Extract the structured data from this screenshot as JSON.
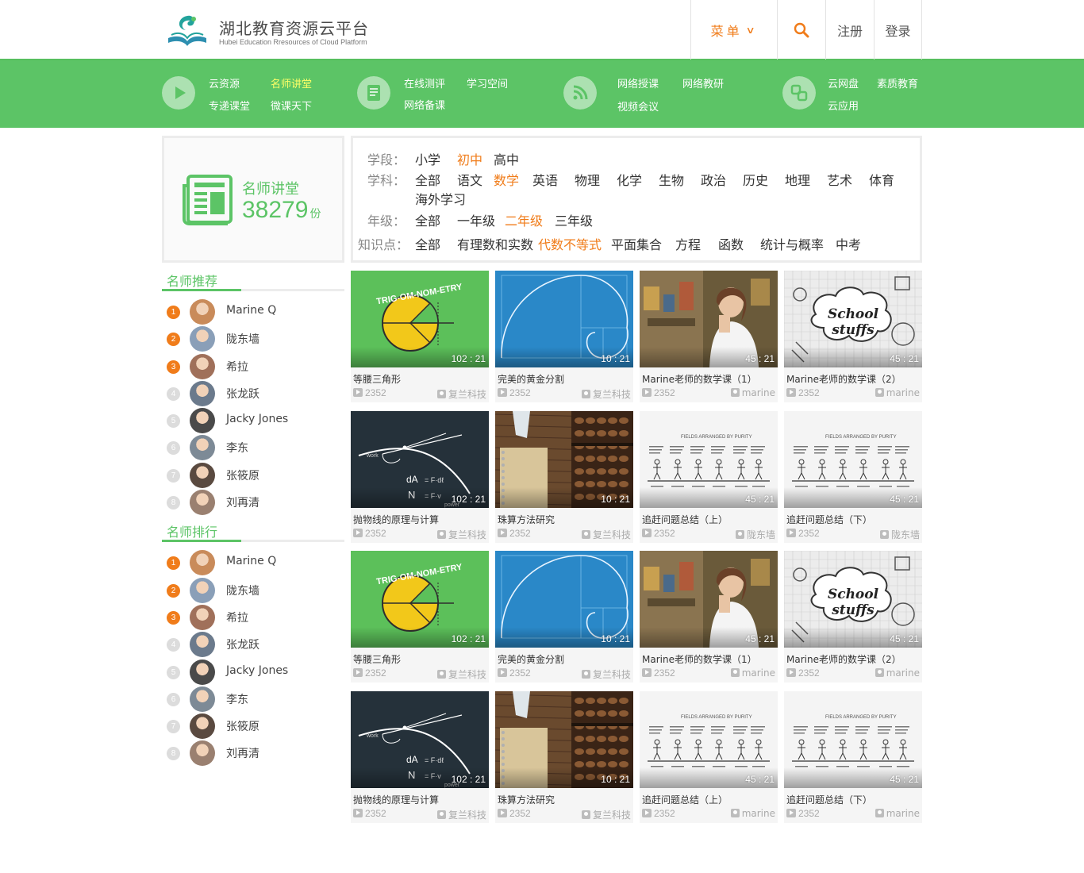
{
  "header": {
    "logo_title": "湖北教育资源云平台",
    "logo_subtitle": "Hubei Education Rresources of Cloud Platform",
    "menu_label": "菜单",
    "register_label": "注册",
    "login_label": "登录"
  },
  "green_nav": {
    "groups": [
      {
        "icon": "play-circle-icon",
        "links": [
          "云资源",
          "名师讲堂",
          "专递课堂",
          "微课天下"
        ]
      },
      {
        "icon": "document-icon",
        "links": [
          "在线测评",
          "学习空间",
          "网络备课"
        ]
      },
      {
        "icon": "rss-icon",
        "links": [
          "网络授课",
          "网络教研",
          "视频会议"
        ]
      },
      {
        "icon": "cloud-app-icon",
        "links": [
          "云网盘",
          "素质教育",
          "云应用"
        ]
      }
    ],
    "active": "名师讲堂"
  },
  "stat": {
    "label": "名师讲堂",
    "count": "38279",
    "unit": "份"
  },
  "filters": {
    "stage": {
      "label": "学段：",
      "options": [
        "小学",
        "初中",
        "高中"
      ],
      "selected": "初中"
    },
    "subject": {
      "label": "学科：",
      "options": [
        "全部",
        "语文",
        "数学",
        "英语",
        "物理",
        "化学",
        "生物",
        "政治",
        "历史",
        "地理",
        "艺术",
        "体育",
        "海外学习"
      ],
      "selected": "数学"
    },
    "grade": {
      "label": "年级：",
      "options": [
        "全部",
        "一年级",
        "二年级",
        "三年级"
      ],
      "selected": "二年级"
    },
    "topic": {
      "label": "知识点：",
      "options": [
        "全部",
        "有理数和实数",
        "代数不等式",
        "平面集合",
        "方程",
        "函数",
        "统计与概率",
        "中考"
      ],
      "selected": "代数不等式"
    }
  },
  "recommend": {
    "title": "名师推荐",
    "teachers": [
      "Marine Q",
      "陇东墙",
      "希拉",
      "张龙跃",
      "Jacky Jones",
      "李东",
      "张筱原",
      "刘再清"
    ]
  },
  "ranking": {
    "title": "名师排行",
    "teachers": [
      "Marine Q",
      "陇东墙",
      "希拉",
      "张龙跃",
      "Jacky Jones",
      "李东",
      "张筱原",
      "刘再清"
    ]
  },
  "cards": [
    {
      "title": "等腰三角形",
      "duration": "102 : 21",
      "views": "2352",
      "author": "复兰科技",
      "thumb": "trig"
    },
    {
      "title": "完美的黄金分割",
      "duration": "10 : 21",
      "views": "2352",
      "author": "复兰科技",
      "thumb": "golden"
    },
    {
      "title": "Marine老师的数学课（1）",
      "duration": "45 : 21",
      "views": "2352",
      "author": "marine",
      "thumb": "photo"
    },
    {
      "title": "Marine老师的数学课（2）",
      "duration": "45 : 21",
      "views": "2352",
      "author": "marine",
      "thumb": "school"
    },
    {
      "title": "抛物线的原理与计算",
      "duration": "102 : 21",
      "views": "2352",
      "author": "复兰科技",
      "thumb": "parabola"
    },
    {
      "title": "珠算方法研究",
      "duration": "10 : 21",
      "views": "2352",
      "author": "复兰科技",
      "thumb": "abacus"
    },
    {
      "title": "追赶问题总结（上）",
      "duration": "45 : 21",
      "views": "2352",
      "author": "陇东墙",
      "thumb": "sketch"
    },
    {
      "title": "追赶问题总结（下）",
      "duration": "45 : 21",
      "views": "2352",
      "author": "陇东墙",
      "thumb": "sketch"
    },
    {
      "title": "等腰三角形",
      "duration": "102 : 21",
      "views": "2352",
      "author": "复兰科技",
      "thumb": "trig"
    },
    {
      "title": "完美的黄金分割",
      "duration": "10 : 21",
      "views": "2352",
      "author": "复兰科技",
      "thumb": "golden"
    },
    {
      "title": "Marine老师的数学课（1）",
      "duration": "45 : 21",
      "views": "2352",
      "author": "marine",
      "thumb": "photo"
    },
    {
      "title": "Marine老师的数学课（2）",
      "duration": "45 : 21",
      "views": "2352",
      "author": "marine",
      "thumb": "school"
    },
    {
      "title": "抛物线的原理与计算",
      "duration": "102 : 21",
      "views": "2352",
      "author": "复兰科技",
      "thumb": "parabola"
    },
    {
      "title": "珠算方法研究",
      "duration": "10 : 21",
      "views": "2352",
      "author": "复兰科技",
      "thumb": "abacus"
    },
    {
      "title": "追赶问题总结（上）",
      "duration": "45 : 21",
      "views": "2352",
      "author": "marine",
      "thumb": "sketch"
    },
    {
      "title": "追赶问题总结（下）",
      "duration": "45 : 21",
      "views": "2352",
      "author": "marine",
      "thumb": "sketch"
    }
  ],
  "thumb_text": {
    "trig": "TRIG-OM-NOM-ETRY",
    "school_line1": "School",
    "school_line2": "stuffs",
    "parabola_work": "work",
    "parabola_power": "power",
    "parabola_formula1": "dA",
    "parabola_formula2": "N"
  },
  "colors": {
    "brand_green": "#5cc466",
    "accent_orange": "#f07c1a",
    "active_yellow": "#ffff66"
  }
}
